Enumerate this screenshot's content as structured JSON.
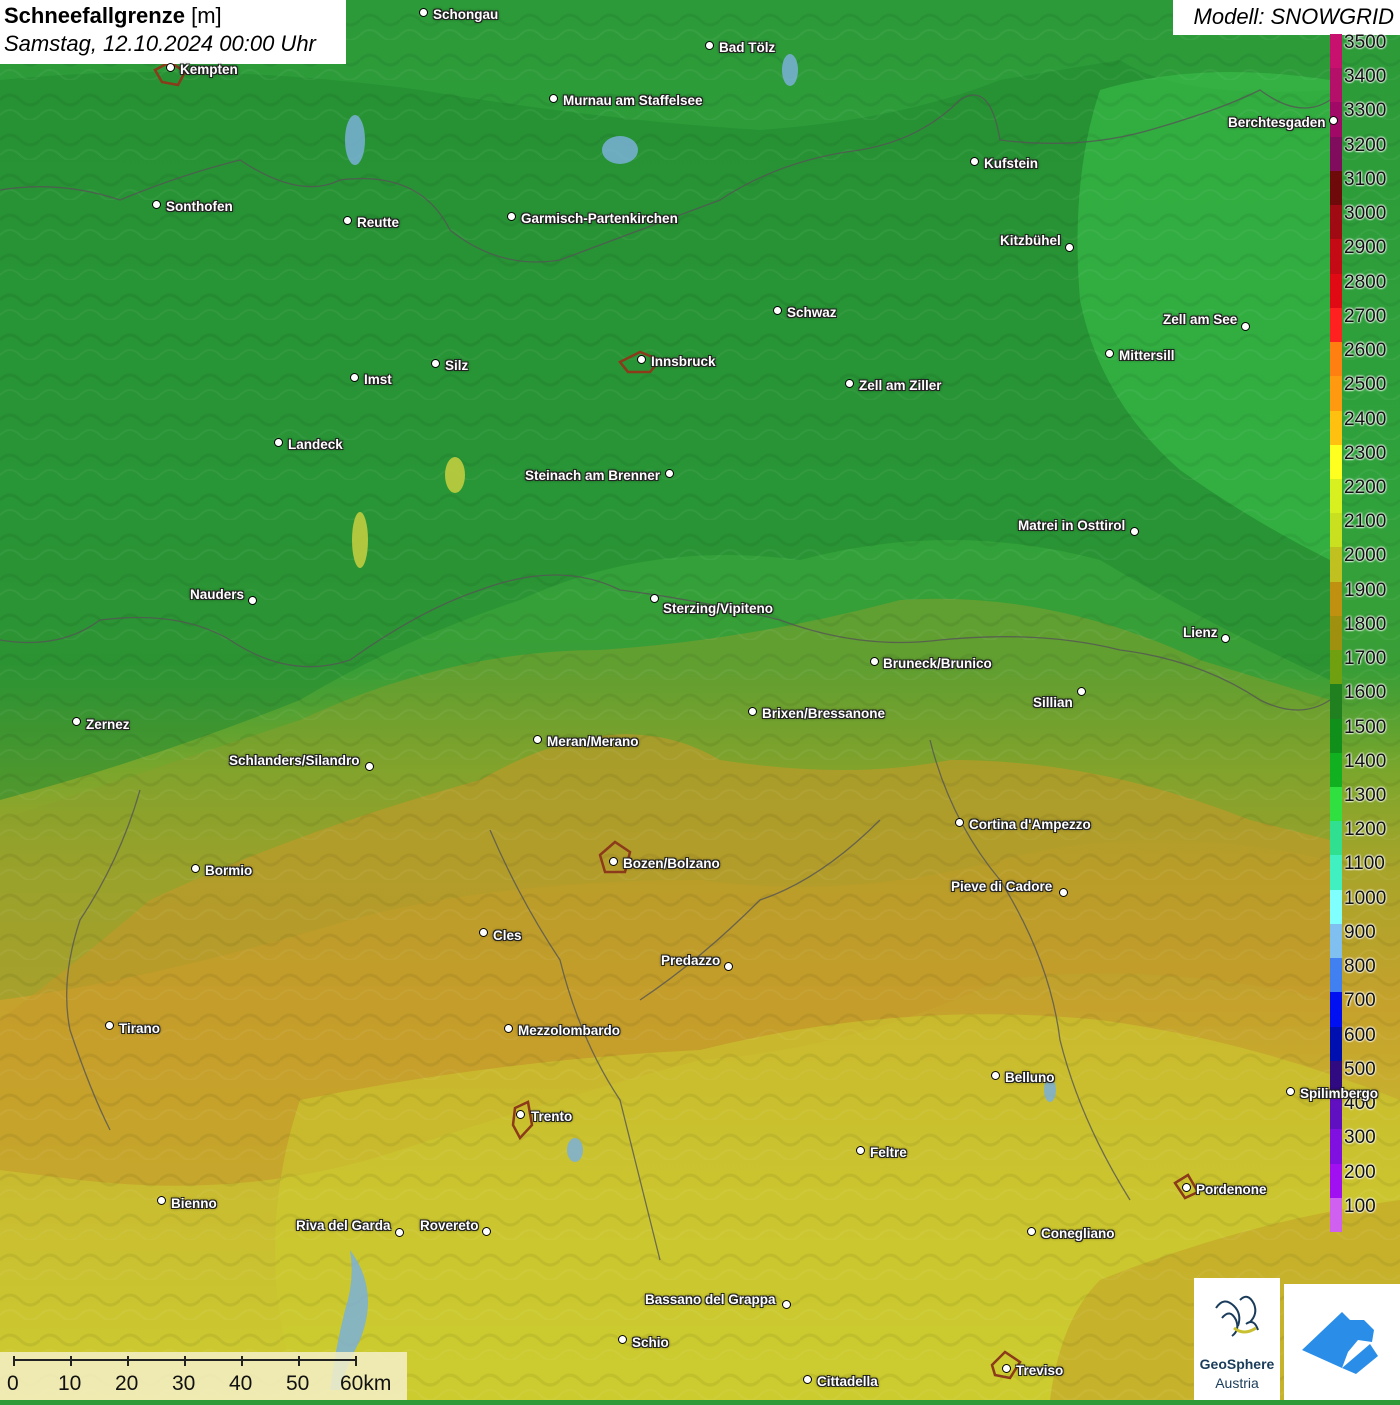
{
  "title": {
    "main_bold": "Schneefallgrenze",
    "main_unit": "[m]",
    "subtitle": "Samstag, 12.10.2024 00:00 Uhr"
  },
  "model_label": "Modell: SNOWGRID",
  "legend": {
    "values": [
      "3500",
      "3400",
      "3300",
      "3200",
      "3100",
      "3000",
      "2900",
      "2800",
      "2700",
      "2600",
      "2500",
      "2400",
      "2300",
      "2200",
      "2100",
      "2000",
      "1900",
      "1800",
      "1700",
      "1600",
      "1500",
      "1400",
      "1300",
      "1200",
      "1100",
      "1000",
      "900",
      "800",
      "700",
      "600",
      "500",
      "400",
      "300",
      "200",
      "100"
    ],
    "colors": [
      "#c8106e",
      "#b4106a",
      "#a00a66",
      "#800c5e",
      "#6e0a0a",
      "#a00a12",
      "#c40a14",
      "#e00a14",
      "#ff2020",
      "#ff8010",
      "#ff9a10",
      "#ffc010",
      "#ffff20",
      "#d8f020",
      "#c8e020",
      "#c0c020",
      "#c09010",
      "#a09010",
      "#70a010",
      "#208020",
      "#10901a",
      "#10b020",
      "#30e040",
      "#30e090",
      "#40f0c0",
      "#80ffff",
      "#80c0f0",
      "#4080f0",
      "#0010f0",
      "#0010b0",
      "#300a80",
      "#6010c0",
      "#8010e0",
      "#a010f0",
      "#d060f0"
    ]
  },
  "cities": [
    {
      "name": "Schongau",
      "dot": [
        424,
        13
      ],
      "label": [
        433,
        7
      ]
    },
    {
      "name": "Bad Tölz",
      "dot": [
        710,
        46
      ],
      "label": [
        719,
        40
      ]
    },
    {
      "name": "Kempten",
      "dot": [
        171,
        68
      ],
      "label": [
        180,
        62
      ]
    },
    {
      "name": "Murnau am Staffelsee",
      "dot": [
        554,
        99
      ],
      "label": [
        563,
        93
      ]
    },
    {
      "name": "Berchtesgaden",
      "dot": [
        1334,
        121
      ],
      "label": [
        1228,
        115
      ]
    },
    {
      "name": "Kufstein",
      "dot": [
        975,
        162
      ],
      "label": [
        984,
        156
      ]
    },
    {
      "name": "Sonthofen",
      "dot": [
        157,
        205
      ],
      "label": [
        166,
        199
      ]
    },
    {
      "name": "Reutte",
      "dot": [
        348,
        221
      ],
      "label": [
        357,
        215
      ]
    },
    {
      "name": "Garmisch-Partenkirchen",
      "dot": [
        512,
        217
      ],
      "label": [
        521,
        211
      ]
    },
    {
      "name": "Kitzbühel",
      "dot": [
        1070,
        248
      ],
      "label": [
        1000,
        233
      ]
    },
    {
      "name": "Schwaz",
      "dot": [
        778,
        311
      ],
      "label": [
        787,
        305
      ]
    },
    {
      "name": "Zell am See",
      "dot": [
        1246,
        327
      ],
      "label": [
        1163,
        312
      ]
    },
    {
      "name": "Innsbruck",
      "dot": [
        642,
        360
      ],
      "label": [
        651,
        354
      ]
    },
    {
      "name": "Mittersill",
      "dot": [
        1110,
        354
      ],
      "label": [
        1119,
        348
      ]
    },
    {
      "name": "Silz",
      "dot": [
        436,
        364
      ],
      "label": [
        445,
        358
      ]
    },
    {
      "name": "Imst",
      "dot": [
        355,
        378
      ],
      "label": [
        364,
        372
      ]
    },
    {
      "name": "Zell am Ziller",
      "dot": [
        850,
        384
      ],
      "label": [
        859,
        378
      ]
    },
    {
      "name": "Landeck",
      "dot": [
        279,
        443
      ],
      "label": [
        288,
        437
      ]
    },
    {
      "name": "Steinach am Brenner",
      "dot": [
        670,
        474
      ],
      "label": [
        525,
        468
      ]
    },
    {
      "name": "Matrei in Osttirol",
      "dot": [
        1135,
        532
      ],
      "label": [
        1018,
        518
      ]
    },
    {
      "name": "Nauders",
      "dot": [
        253,
        601
      ],
      "label": [
        190,
        587
      ]
    },
    {
      "name": "Sterzing/Vipiteno",
      "dot": [
        655,
        599
      ],
      "label": [
        663,
        601
      ]
    },
    {
      "name": "Lienz",
      "dot": [
        1226,
        639
      ],
      "label": [
        1183,
        625
      ]
    },
    {
      "name": "Bruneck/Brunico",
      "dot": [
        875,
        662
      ],
      "label": [
        883,
        656
      ]
    },
    {
      "name": "Sillian",
      "dot": [
        1082,
        692
      ],
      "label": [
        1033,
        695
      ]
    },
    {
      "name": "Brixen/Bressanone",
      "dot": [
        753,
        712
      ],
      "label": [
        762,
        706
      ]
    },
    {
      "name": "Zernez",
      "dot": [
        77,
        722
      ],
      "label": [
        86,
        717
      ]
    },
    {
      "name": "Meran/Merano",
      "dot": [
        538,
        740
      ],
      "label": [
        547,
        734
      ]
    },
    {
      "name": "Schlanders/Silandro",
      "dot": [
        370,
        767
      ],
      "label": [
        229,
        753
      ]
    },
    {
      "name": "Cortina d'Ampezzo",
      "dot": [
        960,
        823
      ],
      "label": [
        969,
        817
      ]
    },
    {
      "name": "Bozen/Bolzano",
      "dot": [
        614,
        862
      ],
      "label": [
        623,
        856
      ]
    },
    {
      "name": "Bormio",
      "dot": [
        196,
        869
      ],
      "label": [
        205,
        863
      ]
    },
    {
      "name": "Pieve di Cadore",
      "dot": [
        1064,
        893
      ],
      "label": [
        951,
        879
      ]
    },
    {
      "name": "Cles",
      "dot": [
        484,
        933
      ],
      "label": [
        493,
        928
      ]
    },
    {
      "name": "Predazzo",
      "dot": [
        729,
        967
      ],
      "label": [
        661,
        953
      ]
    },
    {
      "name": "Tirano",
      "dot": [
        110,
        1026
      ],
      "label": [
        119,
        1021
      ]
    },
    {
      "name": "Mezzolombardo",
      "dot": [
        509,
        1029
      ],
      "label": [
        518,
        1023
      ]
    },
    {
      "name": "Belluno",
      "dot": [
        996,
        1076
      ],
      "label": [
        1005,
        1070
      ]
    },
    {
      "name": "Spilimbergo",
      "dot": [
        1291,
        1092
      ],
      "label": [
        1300,
        1086
      ]
    },
    {
      "name": "Trento",
      "dot": [
        521,
        1115
      ],
      "label": [
        531,
        1109
      ]
    },
    {
      "name": "Feltre",
      "dot": [
        861,
        1151
      ],
      "label": [
        870,
        1145
      ]
    },
    {
      "name": "Pordenone",
      "dot": [
        1187,
        1188
      ],
      "label": [
        1196,
        1182
      ]
    },
    {
      "name": "Bienno",
      "dot": [
        162,
        1201
      ],
      "label": [
        171,
        1196
      ]
    },
    {
      "name": "Riva del Garda",
      "dot": [
        400,
        1233
      ],
      "label": [
        296,
        1218
      ]
    },
    {
      "name": "Rovereto",
      "dot": [
        487,
        1232
      ],
      "label": [
        420,
        1218
      ]
    },
    {
      "name": "Conegliano",
      "dot": [
        1032,
        1232
      ],
      "label": [
        1041,
        1226
      ]
    },
    {
      "name": "Bassano del Grappa",
      "dot": [
        787,
        1305
      ],
      "label": [
        645,
        1292
      ]
    },
    {
      "name": "Schio",
      "dot": [
        623,
        1340
      ],
      "label": [
        632,
        1335
      ]
    },
    {
      "name": "Treviso",
      "dot": [
        1007,
        1369
      ],
      "label": [
        1016,
        1363
      ]
    },
    {
      "name": "Cittadella",
      "dot": [
        808,
        1380
      ],
      "label": [
        817,
        1374
      ]
    }
  ],
  "scale_bar": {
    "labels": [
      "0",
      "10",
      "20",
      "30",
      "40",
      "50",
      "60km"
    ]
  },
  "logo": {
    "line1": "GeoSphere",
    "line2": "Austria"
  }
}
